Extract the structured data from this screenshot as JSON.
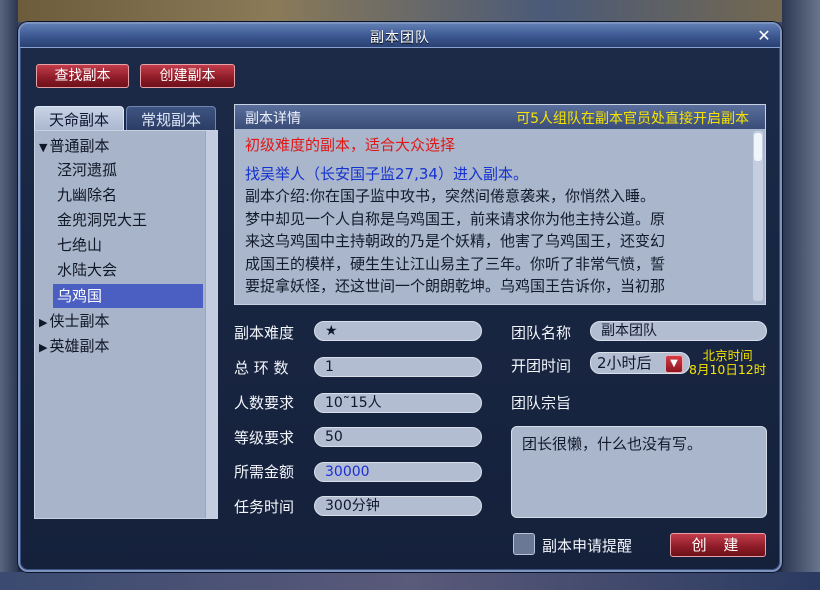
{
  "window": {
    "title": "副本团队",
    "close": "✕"
  },
  "top_buttons": {
    "find": "查找副本",
    "create": "创建副本"
  },
  "tabs": [
    {
      "label": "天命副本",
      "active": true
    },
    {
      "label": "常规副本",
      "active": false
    }
  ],
  "tree": [
    {
      "label": "普通副本",
      "type": "category",
      "expanded": true
    },
    {
      "label": "泾河遗孤",
      "type": "item"
    },
    {
      "label": "九幽除名",
      "type": "item"
    },
    {
      "label": "金兜洞兕大王",
      "type": "item"
    },
    {
      "label": "七绝山",
      "type": "item"
    },
    {
      "label": "水陆大会",
      "type": "item"
    },
    {
      "label": "乌鸡国",
      "type": "item",
      "selected": true
    },
    {
      "label": "侠士副本",
      "type": "category",
      "expanded": false
    },
    {
      "label": "英雄副本",
      "type": "category",
      "expanded": false
    }
  ],
  "detail": {
    "header_left": "副本详情",
    "header_right": "可5人组队在副本官员处直接开启副本",
    "difficulty_line": "初级难度的副本，适合大众选择",
    "quest_line": "找吴举人（长安国子监27,34）进入副本。",
    "intro_lines": [
      "副本介绍:你在国子监中攻书，突然间倦意袭来，你悄然入睡。",
      "梦中却见一个人自称是乌鸡国王，前来请求你为他主持公道。原",
      "来这乌鸡国中主持朝政的乃是个妖精，他害了乌鸡国王，还变幻",
      "成国王的模样，硬生生让江山易主了三年。你听了非常气愤，誓",
      "要捉拿妖怪，还这世间一个朗朗乾坤。乌鸡国王告诉你，当初那"
    ]
  },
  "fields": {
    "difficulty": {
      "label": "副本难度",
      "value": "★"
    },
    "rounds": {
      "label": "总 环 数",
      "value": "1"
    },
    "players": {
      "label": "人数要求",
      "value": "10˜15人"
    },
    "level": {
      "label": "等级要求",
      "value": "50"
    },
    "gold": {
      "label": "所需金额",
      "value": "30000"
    },
    "duration": {
      "label": "任务时间",
      "value": "300分钟"
    },
    "team_name": {
      "label": "团队名称",
      "value": "副本团队"
    },
    "start_time": {
      "label": "开团时间",
      "value": "2小时后"
    },
    "beijing_time": {
      "line1": "北京时间",
      "line2": "8月10日12时"
    },
    "motto": {
      "label": "团队宗旨",
      "value": "团长很懒，什么也没有写。"
    }
  },
  "footer": {
    "reminder_label": "副本申请提醒",
    "reminder_checked": false,
    "create_button": "创 建"
  },
  "colors": {
    "accent_red": "#c33c4a",
    "highlight_yellow": "#f6e400",
    "selected_blue": "#4b5fc2"
  }
}
